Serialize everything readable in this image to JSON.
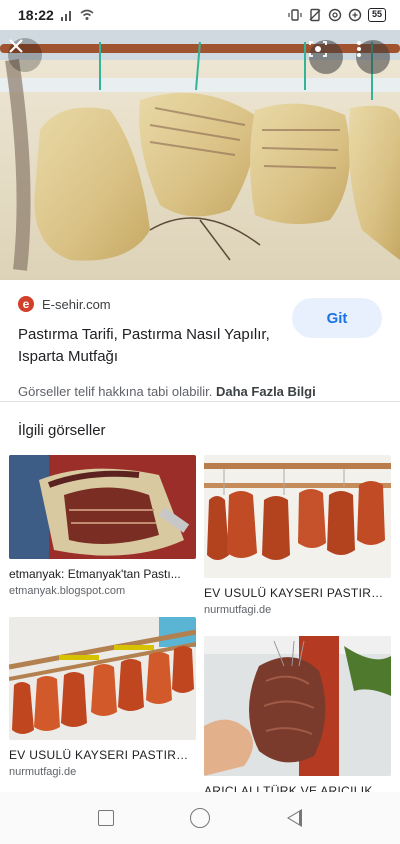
{
  "status_bar": {
    "time": "18:22",
    "battery": "55"
  },
  "hero": {
    "image": "hanging-pastirma-photo"
  },
  "result": {
    "source_name": "E-sehir.com",
    "source_logo_letter": "e",
    "title": "Pastırma Tarifi, Pastırma Nasıl Yapılır, Isparta Mutfağı",
    "visit_label": "Git",
    "copyright_text": "Görseller telif hakkına tabi olabilir.",
    "more_info_label": "Daha Fazla Bilgi"
  },
  "related": {
    "heading": "İlgili görseller",
    "items": [
      {
        "caption": "etmanyak: Etmanyak'tan Pastı...",
        "source": "etmanyak.blogspot.com"
      },
      {
        "caption": "EV USULÜ KAYSERI PASTIRM...",
        "source": "nurmutfagi.de"
      },
      {
        "caption": "EV USULÜ KAYSERI PASTIRM...",
        "source": "nurmutfagi.de"
      },
      {
        "caption": "ARICLALI TÜRK VE ARICILIK B...",
        "source": ""
      }
    ]
  },
  "colors": {
    "accent": "#1a73e8",
    "button_bg": "#e8f0fe",
    "logo_red": "#d23f2b"
  }
}
